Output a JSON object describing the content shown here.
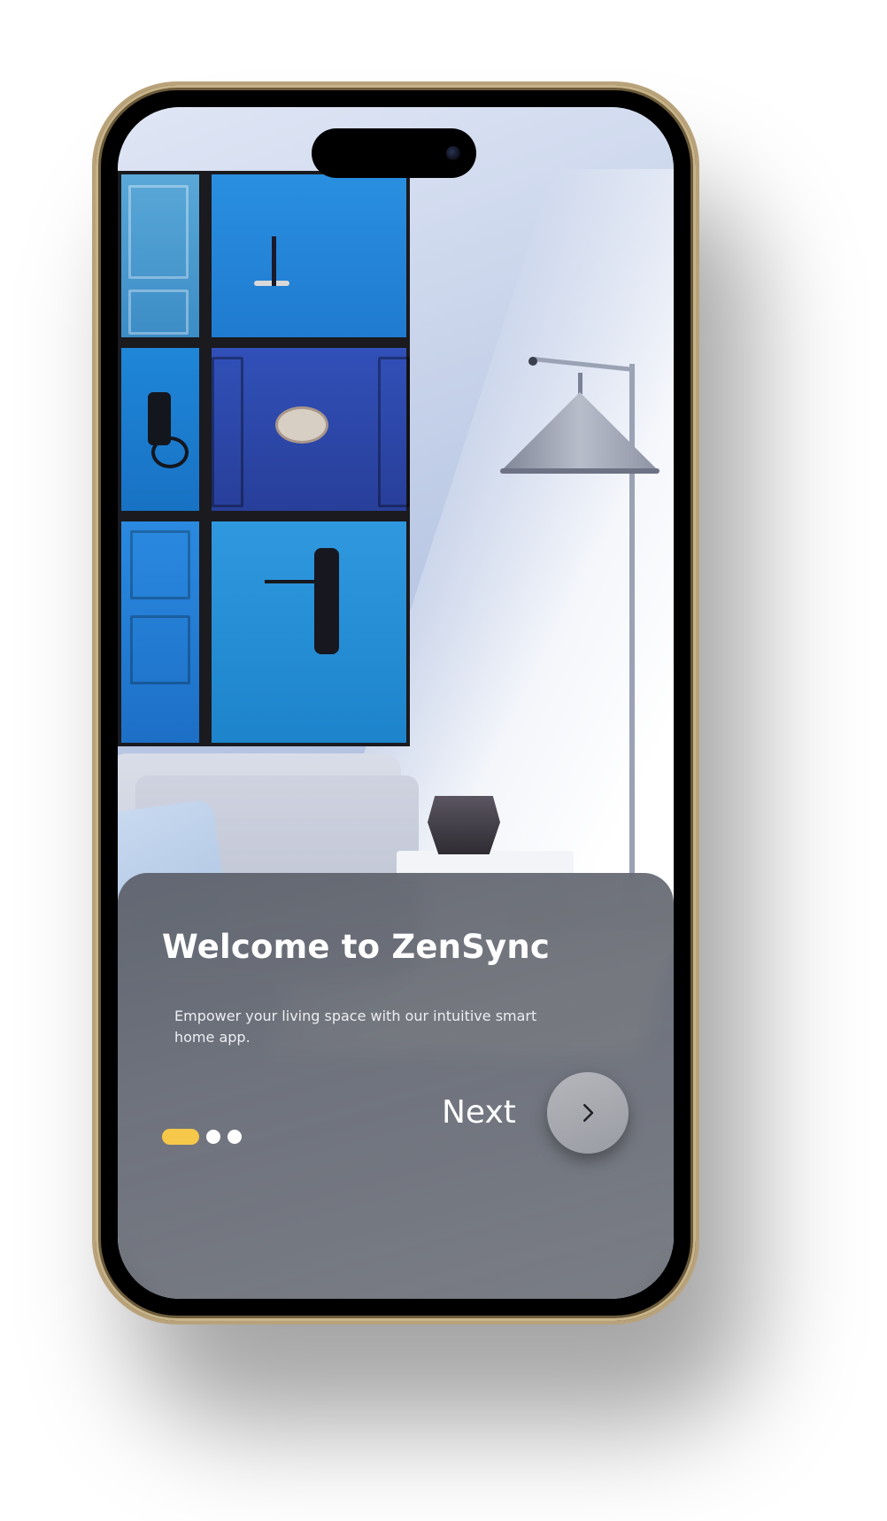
{
  "onboarding": {
    "title": "Welcome to ZenSync",
    "subtitle": "Empower your living space with our intuitive smart home app.",
    "next_label": "Next",
    "pager": {
      "total": 3,
      "active_index": 0
    }
  },
  "icons": {
    "next": "chevron-right-icon"
  },
  "colors": {
    "pager_active": "#f5c84a",
    "pager_inactive": "#ffffff",
    "card_background": "#6a6d75",
    "phone_frame": "#000000",
    "phone_bezel": "#b9a27a"
  }
}
